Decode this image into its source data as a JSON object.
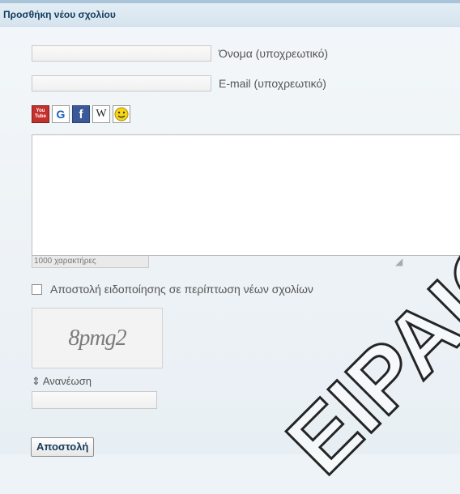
{
  "header": {
    "title": "Προσθήκη νέου σχολίου"
  },
  "form": {
    "name_label": "Όνομα (υποχρεωτικό)",
    "email_label": "E-mail (υποχρεωτικό)",
    "counter_text": "1000 χαρακτήρες",
    "notify_label": "Αποστολή ειδοποίησης σε περίπτωση νέων σχολίων",
    "captcha_text": "8pmg2",
    "refresh_label": "Ανανέωση",
    "submit_label": "Αποστολή"
  },
  "toolbar": {
    "icons": [
      "youtube-icon",
      "google-icon",
      "facebook-icon",
      "wikipedia-icon",
      "smiley-icon"
    ],
    "youtube_text": "You Tube",
    "google_text": "G",
    "facebook_text": "f",
    "wikipedia_text": "W"
  },
  "watermark": {
    "text": "EIPAIO"
  },
  "colors": {
    "header_text": "#123a5c",
    "page_bg": "#eef3f7",
    "facebook_blue": "#3b5998",
    "youtube_red": "#c4302b",
    "smiley_yellow": "#f5d516"
  }
}
